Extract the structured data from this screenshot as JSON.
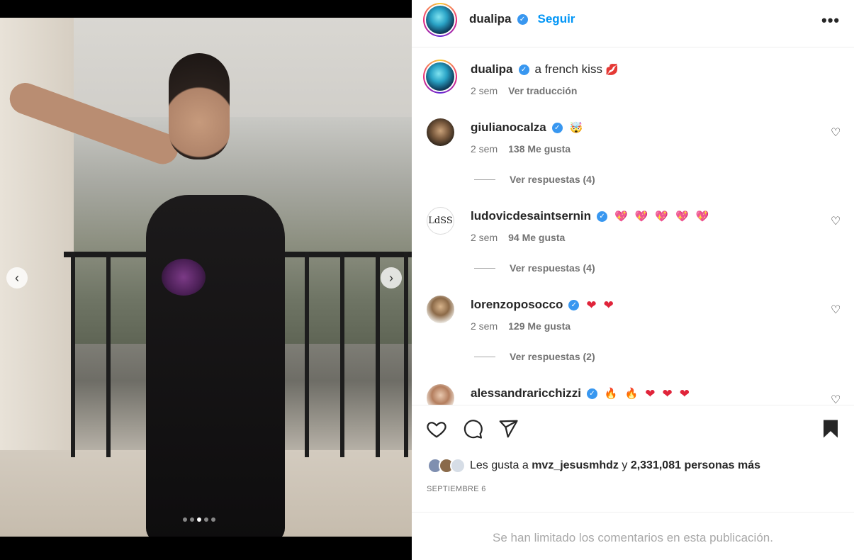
{
  "post": {
    "image_count": 5,
    "active_image_index": 3
  },
  "header": {
    "username": "dualipa",
    "follow_label": "Seguir",
    "more_label": "•••"
  },
  "caption": {
    "username": "dualipa",
    "text": "a french kiss",
    "emoji": "💋",
    "time": "2 sem",
    "translate_label": "Ver traducción"
  },
  "comments": [
    {
      "username": "giulianocalza",
      "emojis": [
        "🤯"
      ],
      "time": "2 sem",
      "likes": "138 Me gusta",
      "replies": "Ver respuestas (4)"
    },
    {
      "username": "ludovicdesaintsernin",
      "avatar_text": "LdSS",
      "emojis": [
        "💖",
        "💖",
        "💖",
        "💖",
        "💖"
      ],
      "time": "2 sem",
      "likes": "94 Me gusta",
      "replies": "Ver respuestas (4)"
    },
    {
      "username": "lorenzoposocco",
      "emojis": [
        "❤",
        "❤"
      ],
      "time": "2 sem",
      "likes": "129 Me gusta",
      "replies": "Ver respuestas (2)"
    },
    {
      "username": "alessandraricchizzi",
      "emojis": [
        "🔥",
        "🔥",
        "❤",
        "❤",
        "❤"
      ]
    }
  ],
  "likes": {
    "prefix": "Les gusta a",
    "user": "mvz_jesusmhdz",
    "connector": "y",
    "count": "2,331,081 personas más"
  },
  "date": "SEPTIEMBRE 6",
  "limited_comments": "Se han limitado los comentarios en esta publicación."
}
